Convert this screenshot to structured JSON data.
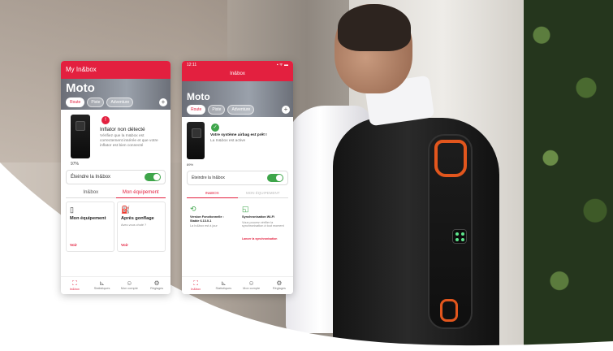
{
  "colors": {
    "brand": "#e3203f",
    "success": "#3ea54a",
    "airbag_accent": "#e2561d"
  },
  "left_phone": {
    "header_title": "My In&box",
    "hero_title": "Moto",
    "chips": [
      "Route",
      "Piste",
      "Adventure"
    ],
    "status_icon": "error-icon",
    "status_title": "Inflator non détecté",
    "status_desc": "Vérifiez que la In&box est correctement insérée et que votre inflator est bien connecté",
    "battery": "97%",
    "toggle_label": "Éteindre la In&box",
    "tabs": [
      "In&box",
      "Mon équipement"
    ],
    "cards": [
      {
        "icon": "device-icon",
        "title": "Mon équipement",
        "desc": "",
        "link": "Voir"
      },
      {
        "icon": "pump-icon",
        "title": "Après gonflage",
        "desc": "Avez-vous chuté ?",
        "link": "Voir"
      }
    ],
    "nav": [
      {
        "icon": "scan-icon",
        "label": "In&box"
      },
      {
        "icon": "chart-icon",
        "label": "Statistiques"
      },
      {
        "icon": "user-icon",
        "label": "Mon compte"
      },
      {
        "icon": "gear-icon",
        "label": "Réglages"
      }
    ]
  },
  "right_phone": {
    "time": "12:11",
    "signal": "▪ ᯤ ▬",
    "header_title": "In&box",
    "hero_title": "Moto",
    "chips": [
      "Route",
      "Piste",
      "Adventure"
    ],
    "status_icon": "check-icon",
    "status_title": "Votre système airbag est prêt !",
    "status_desc": "La In&box est active",
    "battery": "89%",
    "toggle_label": "Éteindre la In&box",
    "tabs": [
      "IN&BOX",
      "MON ÉQUIPEMENT"
    ],
    "cards": [
      {
        "icon": "refresh-icon",
        "title": "Version Fonctionnelle : Stable 6.13.0-1",
        "desc": "La In&box est à jour",
        "link": ""
      },
      {
        "icon": "wifi-icon",
        "title": "Synchronisation Wi-Fi",
        "desc": "Vous pouvez vérifier la synchronisation à tout moment",
        "link": "Lancer la synchronisation"
      }
    ],
    "nav": [
      {
        "icon": "scan-icon",
        "label": "In&box"
      },
      {
        "icon": "chart-icon",
        "label": "Statistiques"
      },
      {
        "icon": "user-icon",
        "label": "Mon compte"
      },
      {
        "icon": "gear-icon",
        "label": "Réglages"
      }
    ]
  }
}
